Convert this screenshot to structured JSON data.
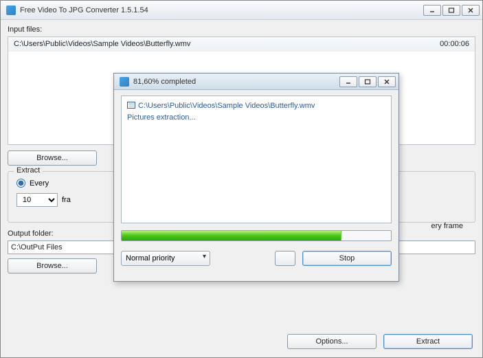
{
  "app": {
    "title": "Free Video To JPG Converter 1.5.1.54"
  },
  "labels": {
    "input_files": "Input files:",
    "output_folder": "Output folder:"
  },
  "file": {
    "path": "C:\\Users\\Public\\Videos\\Sample Videos\\Butterfly.wmv",
    "duration": "00:00:06"
  },
  "buttons": {
    "browse": "Browse...",
    "options": "Options...",
    "extract": "Extract",
    "stop": "Stop"
  },
  "extract": {
    "legend": "Extract",
    "every_label": "Every",
    "every_value": "10",
    "frames_suffix": "fra",
    "every_frame_label": "ery frame"
  },
  "output": {
    "path": "C:\\OutPut Files"
  },
  "dialog": {
    "title": "81,60% completed",
    "log_file": "C:\\Users\\Public\\Videos\\Sample Videos\\Butterfly.wmv",
    "log_status": "Pictures extraction...",
    "priority": "Normal priority",
    "progress_pct": 81.6
  }
}
